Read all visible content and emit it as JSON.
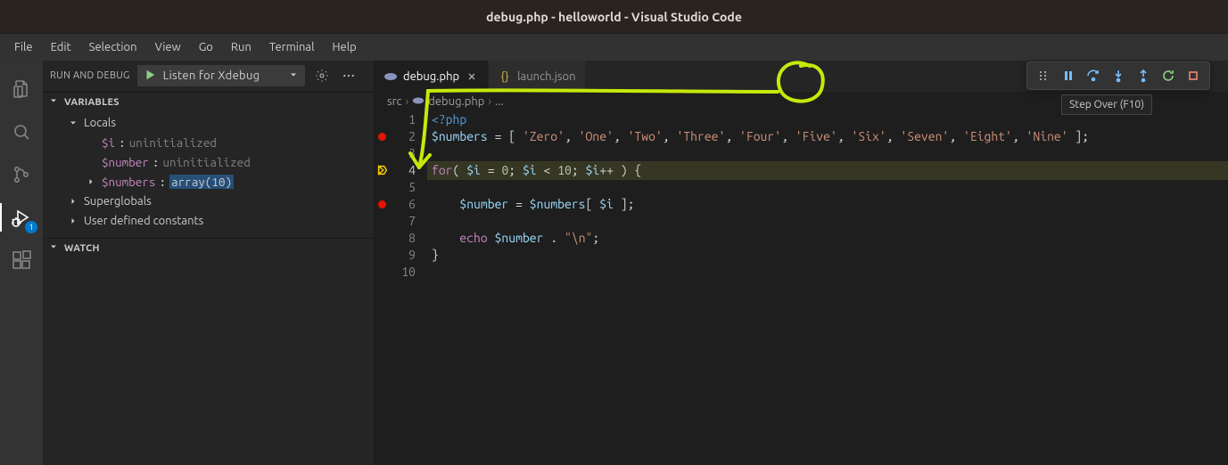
{
  "window": {
    "title": "debug.php - helloworld - Visual Studio Code"
  },
  "menu": [
    "File",
    "Edit",
    "Selection",
    "View",
    "Go",
    "Run",
    "Terminal",
    "Help"
  ],
  "activity": {
    "items": [
      "explorer",
      "search",
      "scm",
      "run-debug",
      "extensions"
    ],
    "active": "run-debug",
    "debug_badge": "1"
  },
  "sidebar": {
    "title": "RUN AND DEBUG",
    "config": "Listen for Xdebug",
    "sections": {
      "variables": {
        "label": "VARIABLES",
        "locals_label": "Locals",
        "superglobals_label": "Superglobals",
        "userconst_label": "User defined constants",
        "locals": [
          {
            "name": "$i",
            "value": "uninitialized"
          },
          {
            "name": "$number",
            "value": "uninitialized"
          },
          {
            "name": "$numbers",
            "value": "array(10)",
            "expandable": true,
            "highlight": true
          }
        ]
      },
      "watch": {
        "label": "WATCH"
      }
    }
  },
  "tabs": [
    {
      "file": "debug.php",
      "icon": "php",
      "active": true
    },
    {
      "file": "launch.json",
      "icon": "json",
      "active": false
    }
  ],
  "breadcrumb": [
    "src",
    "debug.php",
    "..."
  ],
  "debug_toolbar": {
    "tooltip": "Step Over (F10)"
  },
  "code": {
    "lines": [
      {
        "n": 1,
        "tokens": [
          [
            "php",
            "<?php"
          ]
        ]
      },
      {
        "n": 2,
        "bp": true,
        "tokens": [
          [
            "var",
            "$numbers"
          ],
          [
            "op",
            " = [ "
          ],
          [
            "str",
            "'Zero'"
          ],
          [
            "op",
            ", "
          ],
          [
            "str",
            "'One'"
          ],
          [
            "op",
            ", "
          ],
          [
            "str",
            "'Two'"
          ],
          [
            "op",
            ", "
          ],
          [
            "str",
            "'Three'"
          ],
          [
            "op",
            ", "
          ],
          [
            "str",
            "'Four'"
          ],
          [
            "op",
            ", "
          ],
          [
            "str",
            "'Five'"
          ],
          [
            "op",
            ", "
          ],
          [
            "str",
            "'Six'"
          ],
          [
            "op",
            ", "
          ],
          [
            "str",
            "'Seven'"
          ],
          [
            "op",
            ", "
          ],
          [
            "str",
            "'Eight'"
          ],
          [
            "op",
            ", "
          ],
          [
            "str",
            "'Nine'"
          ],
          [
            "op",
            " ];"
          ]
        ]
      },
      {
        "n": 3,
        "tokens": []
      },
      {
        "n": 4,
        "current": true,
        "tokens": [
          [
            "kw",
            "for"
          ],
          [
            "op",
            "( "
          ],
          [
            "var",
            "$i"
          ],
          [
            "op",
            " = "
          ],
          [
            "num",
            "0"
          ],
          [
            "op",
            "; "
          ],
          [
            "var",
            "$i"
          ],
          [
            "op",
            " < "
          ],
          [
            "num",
            "10"
          ],
          [
            "op",
            "; "
          ],
          [
            "var",
            "$i"
          ],
          [
            "op",
            "++ ) {"
          ]
        ]
      },
      {
        "n": 5,
        "tokens": []
      },
      {
        "n": 6,
        "bp": true,
        "tokens": [
          [
            "op",
            "    "
          ],
          [
            "var",
            "$number"
          ],
          [
            "op",
            " = "
          ],
          [
            "var",
            "$numbers"
          ],
          [
            "op",
            "[ "
          ],
          [
            "var",
            "$i"
          ],
          [
            "op",
            " ];"
          ]
        ]
      },
      {
        "n": 7,
        "tokens": []
      },
      {
        "n": 8,
        "tokens": [
          [
            "op",
            "    "
          ],
          [
            "kw",
            "echo"
          ],
          [
            "op",
            " "
          ],
          [
            "var",
            "$number"
          ],
          [
            "op",
            " . "
          ],
          [
            "str",
            "\"\\n\""
          ],
          [
            "op",
            ";"
          ]
        ]
      },
      {
        "n": 9,
        "tokens": [
          [
            "op",
            "}"
          ]
        ]
      },
      {
        "n": 10,
        "tokens": []
      }
    ]
  }
}
